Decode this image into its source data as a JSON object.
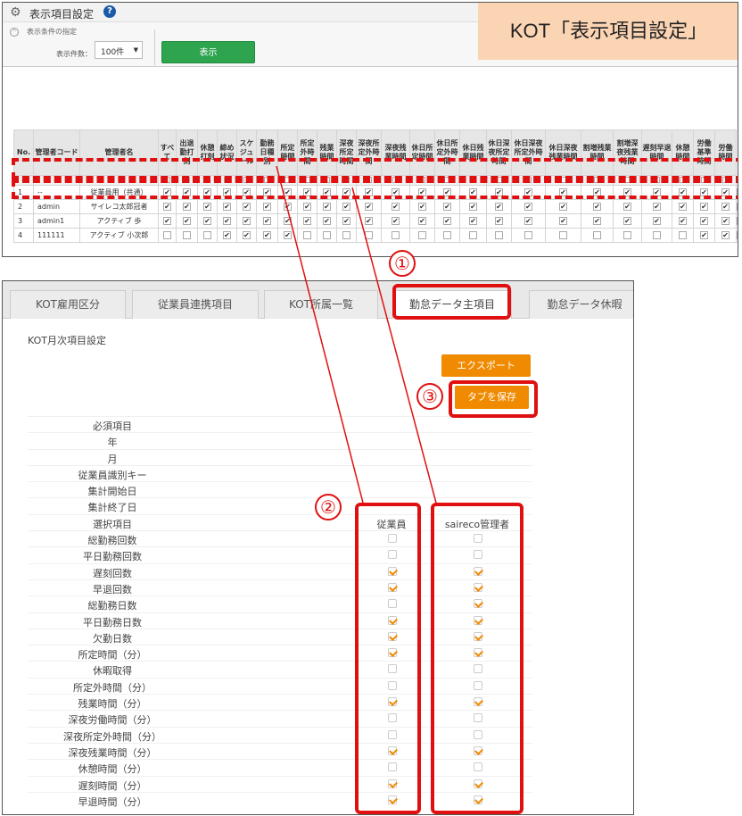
{
  "top": {
    "title": "表示項目設定",
    "help": "?",
    "condition_label": "表示条件の指定",
    "display_count_label": "表示件数：",
    "display_count_value": "100件",
    "show_button": "表示",
    "annotation_title": "KOT「表示項目設定」",
    "columns": [
      "No.",
      "管理者コード",
      "管理者名",
      "すべて",
      "出退勤打刻",
      "休憩打刻",
      "締め状況",
      "スケジュール",
      "勤務日種別",
      "所定時間",
      "所定外時間",
      "残業時間",
      "深夜所定時間",
      "深夜所定外時間",
      "深夜残業時間",
      "休日所定時間",
      "休日所定外時間",
      "休日残業時間",
      "休日深夜所定時間",
      "休日深夜所定外時間",
      "休日深夜残業時間",
      "割増残業時間",
      "割増深夜残業時間",
      "遅刻早退時間",
      "休憩時間",
      "労働基準時間",
      "労働時間"
    ],
    "rows": [
      {
        "no": "1",
        "code": "--",
        "name": "従業員用（共通）",
        "checks": [
          1,
          1,
          1,
          1,
          1,
          1,
          1,
          1,
          1,
          1,
          1,
          1,
          1,
          1,
          1,
          1,
          1,
          1,
          1,
          1,
          1,
          1,
          1,
          1
        ]
      },
      {
        "no": "2",
        "code": "admin",
        "name": "サイレコ太郎冠者",
        "checks": [
          1,
          1,
          1,
          1,
          1,
          1,
          1,
          1,
          1,
          1,
          1,
          1,
          1,
          1,
          1,
          1,
          1,
          1,
          1,
          1,
          1,
          1,
          1,
          1
        ]
      },
      {
        "no": "3",
        "code": "admin1",
        "name": "アクティブ 歩",
        "checks": [
          1,
          1,
          1,
          1,
          1,
          1,
          1,
          1,
          1,
          1,
          1,
          1,
          1,
          1,
          1,
          1,
          1,
          1,
          1,
          1,
          1,
          1,
          1,
          1
        ]
      },
      {
        "no": "4",
        "code": "111111",
        "name": "アクティブ 小次郎",
        "checks": [
          0,
          0,
          1,
          1,
          1,
          1,
          0,
          0,
          0,
          0,
          0,
          0,
          0,
          0,
          0,
          0,
          0,
          0,
          0,
          0,
          0,
          1,
          1,
          1
        ]
      }
    ]
  },
  "bottom": {
    "tabs": [
      "KOT雇用区分",
      "従業員連携項目",
      "KOT所属一覧",
      "勤怠データ主項目",
      "勤怠データ休暇"
    ],
    "active_tab": 3,
    "section_title": "KOT月次項目設定",
    "export_button": "エクスポート",
    "save_button": "タブを保存",
    "required_items": [
      "必須項目",
      "年",
      "月",
      "従業員識別キー",
      "集計開始日",
      "集計終了日"
    ],
    "select_header": "選択項目",
    "col_employee": "従業員",
    "col_manager": "saireco管理者",
    "items": [
      {
        "label": "総勤務回数",
        "emp": false,
        "mgr": false
      },
      {
        "label": "平日勤務回数",
        "emp": false,
        "mgr": false
      },
      {
        "label": "遅刻回数",
        "emp": true,
        "mgr": true
      },
      {
        "label": "早退回数",
        "emp": true,
        "mgr": true
      },
      {
        "label": "総勤務日数",
        "emp": false,
        "mgr": true
      },
      {
        "label": "平日勤務日数",
        "emp": true,
        "mgr": true
      },
      {
        "label": "欠勤日数",
        "emp": true,
        "mgr": true
      },
      {
        "label": "所定時間（分）",
        "emp": true,
        "mgr": true
      },
      {
        "label": "休暇取得",
        "emp": false,
        "mgr": false
      },
      {
        "label": "所定外時間（分）",
        "emp": false,
        "mgr": false
      },
      {
        "label": "残業時間（分）",
        "emp": true,
        "mgr": true
      },
      {
        "label": "深夜労働時間（分）",
        "emp": false,
        "mgr": false
      },
      {
        "label": "深夜所定外時間（分）",
        "emp": false,
        "mgr": false
      },
      {
        "label": "深夜残業時間（分）",
        "emp": true,
        "mgr": true
      },
      {
        "label": "休憩時間（分）",
        "emp": false,
        "mgr": false
      },
      {
        "label": "遅刻時間（分）",
        "emp": true,
        "mgr": true
      },
      {
        "label": "早退時間（分）",
        "emp": true,
        "mgr": true
      }
    ]
  },
  "annotations": {
    "n1": "①",
    "n2": "②",
    "n3": "③"
  },
  "colors": {
    "red": "#e01010",
    "orange": "#f08a00",
    "green": "#2ea44f"
  }
}
